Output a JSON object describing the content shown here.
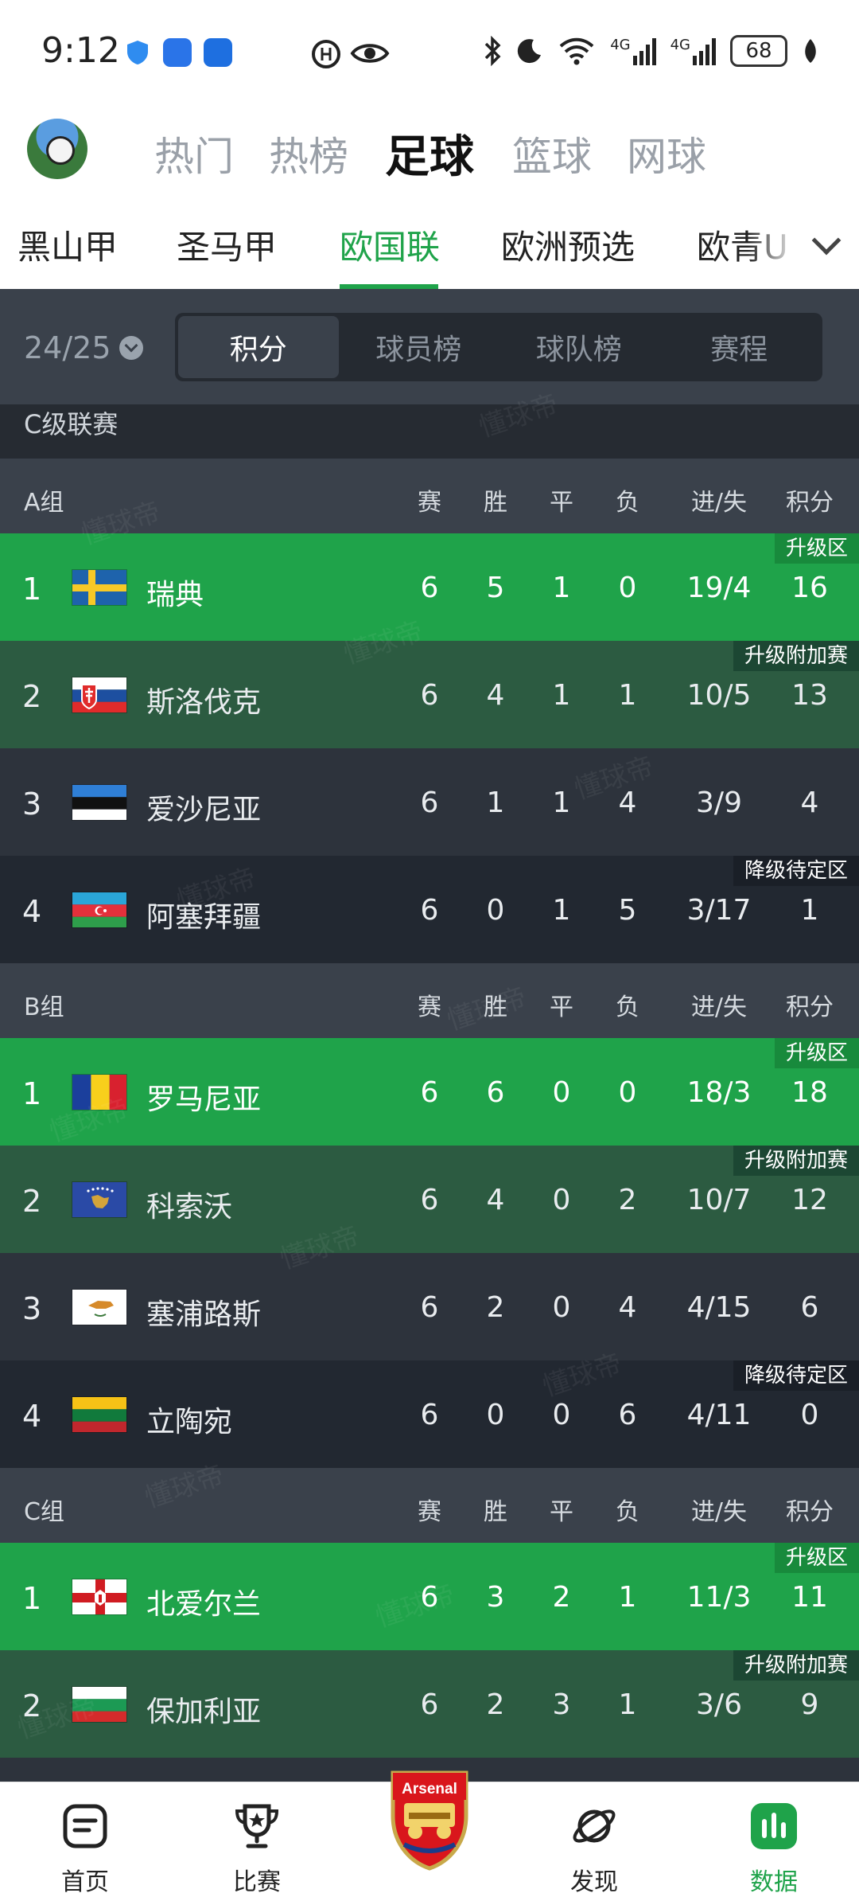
{
  "status_bar": {
    "time": "9:12",
    "battery": "68",
    "network_a": "4G",
    "network_b": "4G"
  },
  "top_nav": {
    "tabs": [
      {
        "label": "热门"
      },
      {
        "label": "热榜"
      },
      {
        "label": "足球",
        "active": true
      },
      {
        "label": "篮球"
      },
      {
        "label": "网球"
      }
    ]
  },
  "league_tabs": {
    "items": [
      {
        "label": "黑山甲"
      },
      {
        "label": "圣马甲"
      },
      {
        "label": "欧国联",
        "active": true
      },
      {
        "label": "欧洲预选"
      },
      {
        "label": "欧青U"
      }
    ]
  },
  "sub_nav": {
    "season": "24/25",
    "segments": [
      {
        "label": "积分",
        "active": true
      },
      {
        "label": "球员榜"
      },
      {
        "label": "球队榜"
      },
      {
        "label": "赛程"
      }
    ]
  },
  "league_label": "C级联赛",
  "watermark": "懂球帝",
  "columns": {
    "played": "赛",
    "won": "胜",
    "drawn": "平",
    "lost": "负",
    "goals": "进/失",
    "points": "积分"
  },
  "groups": [
    {
      "name": "A组",
      "rows": [
        {
          "rank": "1",
          "team": "瑞典",
          "flag": "sweden",
          "played": "6",
          "won": "5",
          "drawn": "1",
          "lost": "0",
          "goals": "19/4",
          "points": "16",
          "zone": "升级区",
          "style": "promo"
        },
        {
          "rank": "2",
          "team": "斯洛伐克",
          "flag": "slovakia",
          "played": "6",
          "won": "4",
          "drawn": "1",
          "lost": "1",
          "goals": "10/5",
          "points": "13",
          "zone": "升级附加赛",
          "style": "playoff"
        },
        {
          "rank": "3",
          "team": "爱沙尼亚",
          "flag": "estonia",
          "played": "6",
          "won": "1",
          "drawn": "1",
          "lost": "4",
          "goals": "3/9",
          "points": "4",
          "zone": "",
          "style": "plain"
        },
        {
          "rank": "4",
          "team": "阿塞拜疆",
          "flag": "azerbaijan",
          "played": "6",
          "won": "0",
          "drawn": "1",
          "lost": "5",
          "goals": "3/17",
          "points": "1",
          "zone": "降级待定区",
          "style": "releg"
        }
      ]
    },
    {
      "name": "B组",
      "rows": [
        {
          "rank": "1",
          "team": "罗马尼亚",
          "flag": "romania",
          "played": "6",
          "won": "6",
          "drawn": "0",
          "lost": "0",
          "goals": "18/3",
          "points": "18",
          "zone": "升级区",
          "style": "promo"
        },
        {
          "rank": "2",
          "team": "科索沃",
          "flag": "kosovo",
          "played": "6",
          "won": "4",
          "drawn": "0",
          "lost": "2",
          "goals": "10/7",
          "points": "12",
          "zone": "升级附加赛",
          "style": "playoff"
        },
        {
          "rank": "3",
          "team": "塞浦路斯",
          "flag": "cyprus",
          "played": "6",
          "won": "2",
          "drawn": "0",
          "lost": "4",
          "goals": "4/15",
          "points": "6",
          "zone": "",
          "style": "plain"
        },
        {
          "rank": "4",
          "team": "立陶宛",
          "flag": "lithuania",
          "played": "6",
          "won": "0",
          "drawn": "0",
          "lost": "6",
          "goals": "4/11",
          "points": "0",
          "zone": "降级待定区",
          "style": "releg"
        }
      ]
    },
    {
      "name": "C组",
      "rows": [
        {
          "rank": "1",
          "team": "北爱尔兰",
          "flag": "northern-ireland",
          "played": "6",
          "won": "3",
          "drawn": "2",
          "lost": "1",
          "goals": "11/3",
          "points": "11",
          "zone": "升级区",
          "style": "promo"
        },
        {
          "rank": "2",
          "team": "保加利亚",
          "flag": "bulgaria",
          "played": "6",
          "won": "2",
          "drawn": "3",
          "lost": "1",
          "goals": "3/6",
          "points": "9",
          "zone": "升级附加赛",
          "style": "playoff"
        }
      ]
    }
  ],
  "bottom_nav": {
    "items": [
      {
        "label": "首页",
        "icon": "home-icon"
      },
      {
        "label": "比赛",
        "icon": "trophy-icon"
      },
      {
        "label": "",
        "icon": "arsenal-crest-icon"
      },
      {
        "label": "发现",
        "icon": "planet-icon"
      },
      {
        "label": "数据",
        "icon": "data-icon",
        "active": true
      }
    ]
  },
  "crest_text": "Arsenal",
  "colors": {
    "accent": "#1fa34a",
    "promo": "#1fa34a",
    "playoff": "#2c5b41",
    "releg": "#222831"
  }
}
